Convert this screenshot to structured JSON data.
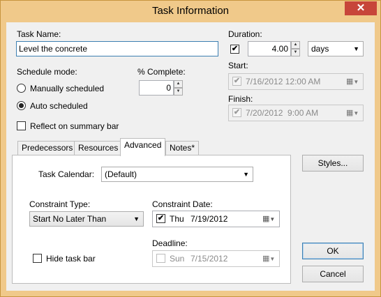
{
  "window": {
    "title": "Task Information",
    "close_glyph": "✕"
  },
  "task_name": {
    "label": "Task Name:",
    "value": "Level the concrete"
  },
  "schedule_mode": {
    "label": "Schedule mode:",
    "options": [
      {
        "label": "Manually scheduled",
        "selected": false
      },
      {
        "label": "Auto scheduled",
        "selected": true
      }
    ]
  },
  "percent_complete": {
    "label": "% Complete:",
    "value": "0"
  },
  "reflect_summary": {
    "label": "Reflect on summary bar",
    "checked": false
  },
  "duration": {
    "label": "Duration:",
    "checked": true,
    "value": "4.00",
    "unit": "days"
  },
  "start": {
    "label": "Start:",
    "checked": true,
    "value": "7/16/2012 12:00 AM"
  },
  "finish": {
    "label": "Finish:",
    "checked": true,
    "value": "7/20/2012  9:00 AM"
  },
  "tabs": [
    {
      "label": "Predecessors",
      "active": false
    },
    {
      "label": "Resources",
      "active": false
    },
    {
      "label": "Advanced",
      "active": true
    },
    {
      "label": "Notes*",
      "active": false
    }
  ],
  "advanced": {
    "task_calendar_label": "Task Calendar:",
    "task_calendar_value": "(Default)",
    "constraint_type_label": "Constraint Type:",
    "constraint_type_value": "Start No Later Than",
    "constraint_date_label": "Constraint Date:",
    "constraint_date_day": "Thu",
    "constraint_date_value": "7/19/2012",
    "constraint_date_checked": true,
    "hide_task_bar_label": "Hide task bar",
    "hide_task_bar_checked": false,
    "deadline_label": "Deadline:",
    "deadline_day": "Sun",
    "deadline_value": "7/15/2012",
    "deadline_checked": false
  },
  "buttons": {
    "styles": "Styles...",
    "ok": "OK",
    "cancel": "Cancel"
  },
  "icons": {
    "checkmark": "✔",
    "dropdown": "▼",
    "spin_up": "▲",
    "spin_down": "▼",
    "calendar": "▦"
  }
}
